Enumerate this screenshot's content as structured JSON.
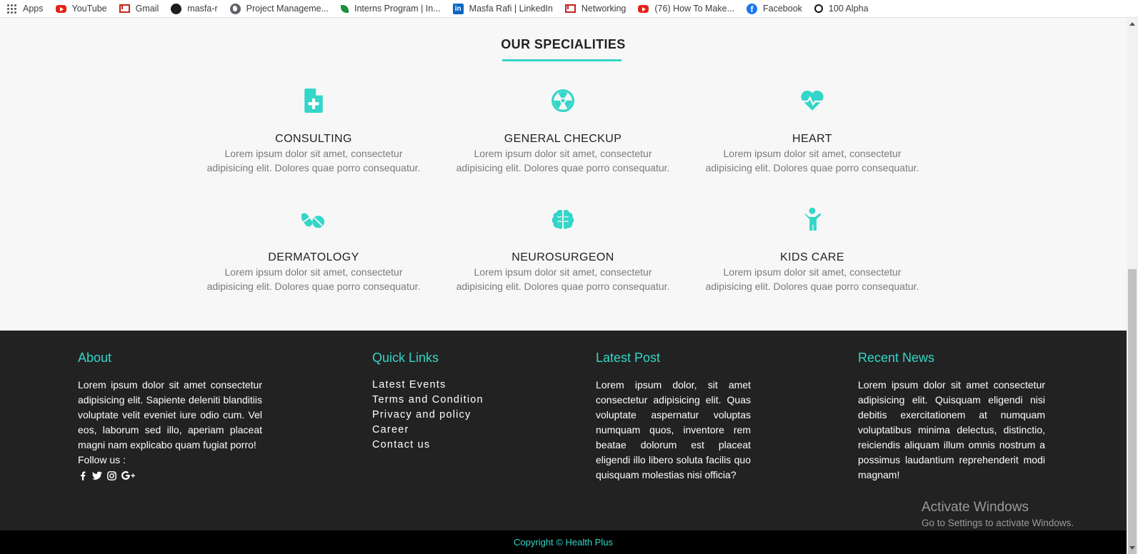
{
  "bookmarks": [
    {
      "label": "Apps"
    },
    {
      "label": "YouTube"
    },
    {
      "label": "Gmail"
    },
    {
      "label": "masfa-r"
    },
    {
      "label": "Project Manageme..."
    },
    {
      "label": "Interns Program | In..."
    },
    {
      "label": "Masfa Rafi | LinkedIn"
    },
    {
      "label": "Networking"
    },
    {
      "label": "(76) How To Make..."
    },
    {
      "label": "Facebook"
    },
    {
      "label": "100 Alpha"
    }
  ],
  "specialities": {
    "title": "OUR SPECIALITIES",
    "items": [
      {
        "name": "CONSULTING",
        "icon": "file-medical-icon",
        "desc": "Lorem ipsum dolor sit amet, consectetur adipisicing elit. Dolores quae porro consequatur."
      },
      {
        "name": "GENERAL CHECKUP",
        "icon": "radiation-icon",
        "desc": "Lorem ipsum dolor sit amet, consectetur adipisicing elit. Dolores quae porro consequatur."
      },
      {
        "name": "HEART",
        "icon": "heartbeat-icon",
        "desc": "Lorem ipsum dolor sit amet, consectetur adipisicing elit. Dolores quae porro consequatur."
      },
      {
        "name": "DERMATOLOGY",
        "icon": "pills-icon",
        "desc": "Lorem ipsum dolor sit amet, consectetur adipisicing elit. Dolores quae porro consequatur."
      },
      {
        "name": "NEUROSURGEON",
        "icon": "brain-icon",
        "desc": "Lorem ipsum dolor sit amet, consectetur adipisicing elit. Dolores quae porro consequatur."
      },
      {
        "name": "KIDS CARE",
        "icon": "child-icon",
        "desc": "Lorem ipsum dolor sit amet, consectetur adipisicing elit. Dolores quae porro consequatur."
      }
    ]
  },
  "footer": {
    "about": {
      "title": "About",
      "text": "Lorem ipsum dolor sit amet consectetur adipisicing elit. Sapiente deleniti blanditiis voluptate velit eveniet iure odio cum. Vel eos, laborum sed illo, aperiam placeat magni nam explicabo quam fugiat porro!",
      "follow_label": "Follow us :",
      "social": [
        "facebook-icon",
        "twitter-icon",
        "instagram-icon",
        "google-plus-icon"
      ]
    },
    "quick_links": {
      "title": "Quick Links",
      "links": [
        "Latest Events",
        "Terms and Condition",
        "Privacy and policy",
        "Career",
        "Contact us"
      ]
    },
    "latest_post": {
      "title": "Latest Post",
      "text": "Lorem ipsum dolor, sit amet consectetur adipisicing elit. Quas voluptate aspernatur voluptas numquam quos, inventore rem beatae dolorum est placeat eligendi illo libero soluta facilis quo quisquam molestias nisi officia?"
    },
    "recent_news": {
      "title": "Recent News",
      "text": "Lorem ipsum dolor sit amet consectetur adipisicing elit. Quisquam eligendi nisi debitis exercitationem at numquam voluptatibus minima delectus, distinctio, reiciendis aliquam illum omnis nostrum a possimus laudantium reprehenderit modi magnam!"
    }
  },
  "watermark": {
    "title": "Activate Windows",
    "subtitle": "Go to Settings to activate Windows."
  },
  "copyright": "Copyright © Health Plus",
  "colors": {
    "accent": "#33d6c8",
    "footer_bg": "#222222",
    "copyright_bg": "#000000",
    "page_bg": "#f7f7f7"
  }
}
